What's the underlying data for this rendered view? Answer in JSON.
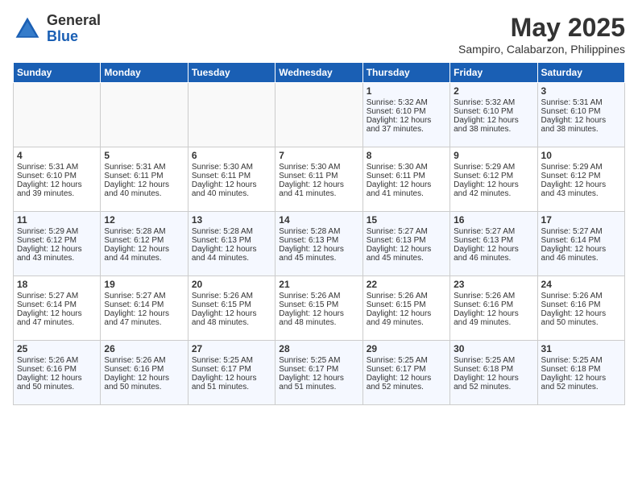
{
  "header": {
    "logo_general": "General",
    "logo_blue": "Blue",
    "month_title": "May 2025",
    "location": "Sampiro, Calabarzon, Philippines"
  },
  "weekdays": [
    "Sunday",
    "Monday",
    "Tuesday",
    "Wednesday",
    "Thursday",
    "Friday",
    "Saturday"
  ],
  "weeks": [
    [
      {
        "day": "",
        "info": ""
      },
      {
        "day": "",
        "info": ""
      },
      {
        "day": "",
        "info": ""
      },
      {
        "day": "",
        "info": ""
      },
      {
        "day": "1",
        "info": "Sunrise: 5:32 AM\nSunset: 6:10 PM\nDaylight: 12 hours\nand 37 minutes."
      },
      {
        "day": "2",
        "info": "Sunrise: 5:32 AM\nSunset: 6:10 PM\nDaylight: 12 hours\nand 38 minutes."
      },
      {
        "day": "3",
        "info": "Sunrise: 5:31 AM\nSunset: 6:10 PM\nDaylight: 12 hours\nand 38 minutes."
      }
    ],
    [
      {
        "day": "4",
        "info": "Sunrise: 5:31 AM\nSunset: 6:10 PM\nDaylight: 12 hours\nand 39 minutes."
      },
      {
        "day": "5",
        "info": "Sunrise: 5:31 AM\nSunset: 6:11 PM\nDaylight: 12 hours\nand 40 minutes."
      },
      {
        "day": "6",
        "info": "Sunrise: 5:30 AM\nSunset: 6:11 PM\nDaylight: 12 hours\nand 40 minutes."
      },
      {
        "day": "7",
        "info": "Sunrise: 5:30 AM\nSunset: 6:11 PM\nDaylight: 12 hours\nand 41 minutes."
      },
      {
        "day": "8",
        "info": "Sunrise: 5:30 AM\nSunset: 6:11 PM\nDaylight: 12 hours\nand 41 minutes."
      },
      {
        "day": "9",
        "info": "Sunrise: 5:29 AM\nSunset: 6:12 PM\nDaylight: 12 hours\nand 42 minutes."
      },
      {
        "day": "10",
        "info": "Sunrise: 5:29 AM\nSunset: 6:12 PM\nDaylight: 12 hours\nand 43 minutes."
      }
    ],
    [
      {
        "day": "11",
        "info": "Sunrise: 5:29 AM\nSunset: 6:12 PM\nDaylight: 12 hours\nand 43 minutes."
      },
      {
        "day": "12",
        "info": "Sunrise: 5:28 AM\nSunset: 6:12 PM\nDaylight: 12 hours\nand 44 minutes."
      },
      {
        "day": "13",
        "info": "Sunrise: 5:28 AM\nSunset: 6:13 PM\nDaylight: 12 hours\nand 44 minutes."
      },
      {
        "day": "14",
        "info": "Sunrise: 5:28 AM\nSunset: 6:13 PM\nDaylight: 12 hours\nand 45 minutes."
      },
      {
        "day": "15",
        "info": "Sunrise: 5:27 AM\nSunset: 6:13 PM\nDaylight: 12 hours\nand 45 minutes."
      },
      {
        "day": "16",
        "info": "Sunrise: 5:27 AM\nSunset: 6:13 PM\nDaylight: 12 hours\nand 46 minutes."
      },
      {
        "day": "17",
        "info": "Sunrise: 5:27 AM\nSunset: 6:14 PM\nDaylight: 12 hours\nand 46 minutes."
      }
    ],
    [
      {
        "day": "18",
        "info": "Sunrise: 5:27 AM\nSunset: 6:14 PM\nDaylight: 12 hours\nand 47 minutes."
      },
      {
        "day": "19",
        "info": "Sunrise: 5:27 AM\nSunset: 6:14 PM\nDaylight: 12 hours\nand 47 minutes."
      },
      {
        "day": "20",
        "info": "Sunrise: 5:26 AM\nSunset: 6:15 PM\nDaylight: 12 hours\nand 48 minutes."
      },
      {
        "day": "21",
        "info": "Sunrise: 5:26 AM\nSunset: 6:15 PM\nDaylight: 12 hours\nand 48 minutes."
      },
      {
        "day": "22",
        "info": "Sunrise: 5:26 AM\nSunset: 6:15 PM\nDaylight: 12 hours\nand 49 minutes."
      },
      {
        "day": "23",
        "info": "Sunrise: 5:26 AM\nSunset: 6:16 PM\nDaylight: 12 hours\nand 49 minutes."
      },
      {
        "day": "24",
        "info": "Sunrise: 5:26 AM\nSunset: 6:16 PM\nDaylight: 12 hours\nand 50 minutes."
      }
    ],
    [
      {
        "day": "25",
        "info": "Sunrise: 5:26 AM\nSunset: 6:16 PM\nDaylight: 12 hours\nand 50 minutes."
      },
      {
        "day": "26",
        "info": "Sunrise: 5:26 AM\nSunset: 6:16 PM\nDaylight: 12 hours\nand 50 minutes."
      },
      {
        "day": "27",
        "info": "Sunrise: 5:25 AM\nSunset: 6:17 PM\nDaylight: 12 hours\nand 51 minutes."
      },
      {
        "day": "28",
        "info": "Sunrise: 5:25 AM\nSunset: 6:17 PM\nDaylight: 12 hours\nand 51 minutes."
      },
      {
        "day": "29",
        "info": "Sunrise: 5:25 AM\nSunset: 6:17 PM\nDaylight: 12 hours\nand 52 minutes."
      },
      {
        "day": "30",
        "info": "Sunrise: 5:25 AM\nSunset: 6:18 PM\nDaylight: 12 hours\nand 52 minutes."
      },
      {
        "day": "31",
        "info": "Sunrise: 5:25 AM\nSunset: 6:18 PM\nDaylight: 12 hours\nand 52 minutes."
      }
    ]
  ]
}
